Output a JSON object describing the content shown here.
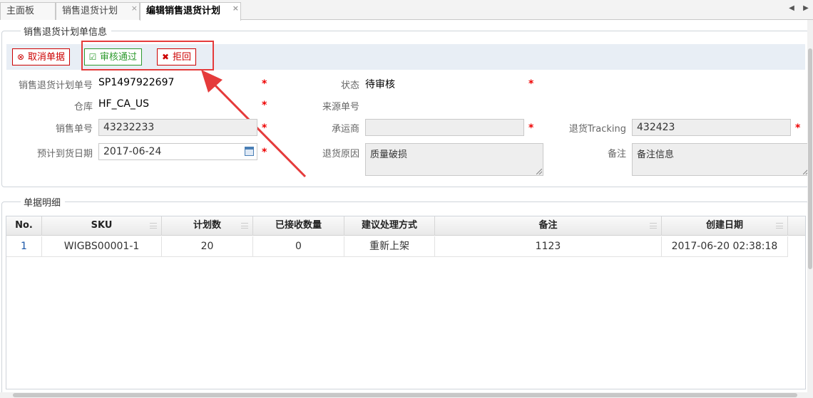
{
  "tabs": [
    {
      "label": "主面板",
      "closable": false
    },
    {
      "label": "销售退货计划",
      "closable": true
    },
    {
      "label": "编辑销售退货计划",
      "closable": true,
      "active": true
    }
  ],
  "tab_nav": {
    "left": "◀",
    "right": "▶"
  },
  "info_section": {
    "title": "销售退货计划单信息"
  },
  "toolbar": {
    "cancel_label": "取消单据",
    "approve_label": "审核通过",
    "reject_label": "拒回"
  },
  "form": {
    "plan_no": {
      "label": "销售退货计划单号",
      "value": "SP1497922697"
    },
    "status": {
      "label": "状态",
      "value": "待审核"
    },
    "warehouse": {
      "label": "仓库",
      "value": "HF_CA_US"
    },
    "source_no": {
      "label": "来源单号",
      "value": ""
    },
    "sales_no": {
      "label": "销售单号",
      "value": "43232233"
    },
    "carrier": {
      "label": "承运商",
      "value": ""
    },
    "tracking": {
      "label": "退货Tracking",
      "value": "432423"
    },
    "eta_date": {
      "label": "预计到货日期",
      "value": "2017-06-24"
    },
    "reason": {
      "label": "退货原因",
      "value": "质量破损"
    },
    "remark": {
      "label": "备注",
      "value": "备注信息"
    },
    "required_mark": "*"
  },
  "detail_section": {
    "title": "单据明细"
  },
  "grid": {
    "columns": [
      "No.",
      "SKU",
      "计划数",
      "已接收数量",
      "建议处理方式",
      "备注",
      "创建日期"
    ],
    "rows": [
      [
        "1",
        "WIGBS00001-1",
        "20",
        "0",
        "重新上架",
        "1123",
        "2017-06-20 02:38:18"
      ]
    ]
  },
  "colors": {
    "accent_red": "#cc0000",
    "accent_green": "#2e9a2e",
    "toolbar_bg": "#e8eef5",
    "annotation": "#e53b3b"
  }
}
